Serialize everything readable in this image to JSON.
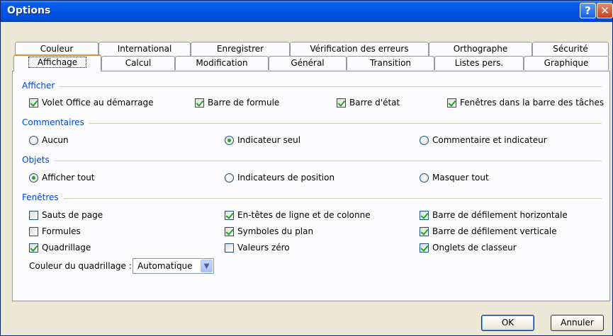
{
  "window": {
    "title": "Options",
    "help_glyph": "?",
    "close_glyph": "✕"
  },
  "tabs_row1": [
    "Couleur",
    "International",
    "Enregistrer",
    "Vérification des erreurs",
    "Orthographe",
    "Sécurité"
  ],
  "tabs_row2": [
    "Affichage",
    "Calcul",
    "Modification",
    "Général",
    "Transition",
    "Listes pers.",
    "Graphique"
  ],
  "selected_tab": "Affichage",
  "groups": {
    "afficher": {
      "title": "Afficher",
      "items": [
        {
          "label": "Volet Office au démarrage",
          "checked": true
        },
        {
          "label": "Barre de formule",
          "checked": true
        },
        {
          "label": "Barre d'état",
          "checked": true
        },
        {
          "label": "Fenêtres dans la barre des tâches",
          "checked": true
        }
      ]
    },
    "commentaires": {
      "title": "Commentaires",
      "items": [
        {
          "label": "Aucun",
          "checked": false
        },
        {
          "label": "Indicateur seul",
          "checked": true
        },
        {
          "label": "Commentaire et indicateur",
          "checked": false
        }
      ]
    },
    "objets": {
      "title": "Objets",
      "items": [
        {
          "label": "Afficher tout",
          "checked": true
        },
        {
          "label": "Indicateurs de position",
          "checked": false
        },
        {
          "label": "Masquer tout",
          "checked": false
        }
      ]
    },
    "fenetres": {
      "title": "Fenêtres",
      "items": [
        {
          "label": "Sauts de page",
          "checked": false
        },
        {
          "label": "Formules",
          "checked": false
        },
        {
          "label": "Quadrillage",
          "checked": true
        },
        {
          "label": "En-têtes de ligne et de colonne",
          "checked": true
        },
        {
          "label": "Symboles du plan",
          "checked": true
        },
        {
          "label": "Valeurs zéro",
          "checked": false
        },
        {
          "label": "Barre de défilement horizontale",
          "checked": true
        },
        {
          "label": "Barre de défilement verticale",
          "checked": true
        },
        {
          "label": "Onglets de classeur",
          "checked": true
        }
      ]
    }
  },
  "gridline_color": {
    "label": "Couleur du quadrillage :",
    "value": "Automatique"
  },
  "buttons": {
    "ok": "OK",
    "cancel": "Annuler"
  },
  "colors": {
    "title_bar": "#0054e3",
    "group_title": "#0046d5",
    "check": "#21a121",
    "tab_highlight": "#e68b2c"
  }
}
